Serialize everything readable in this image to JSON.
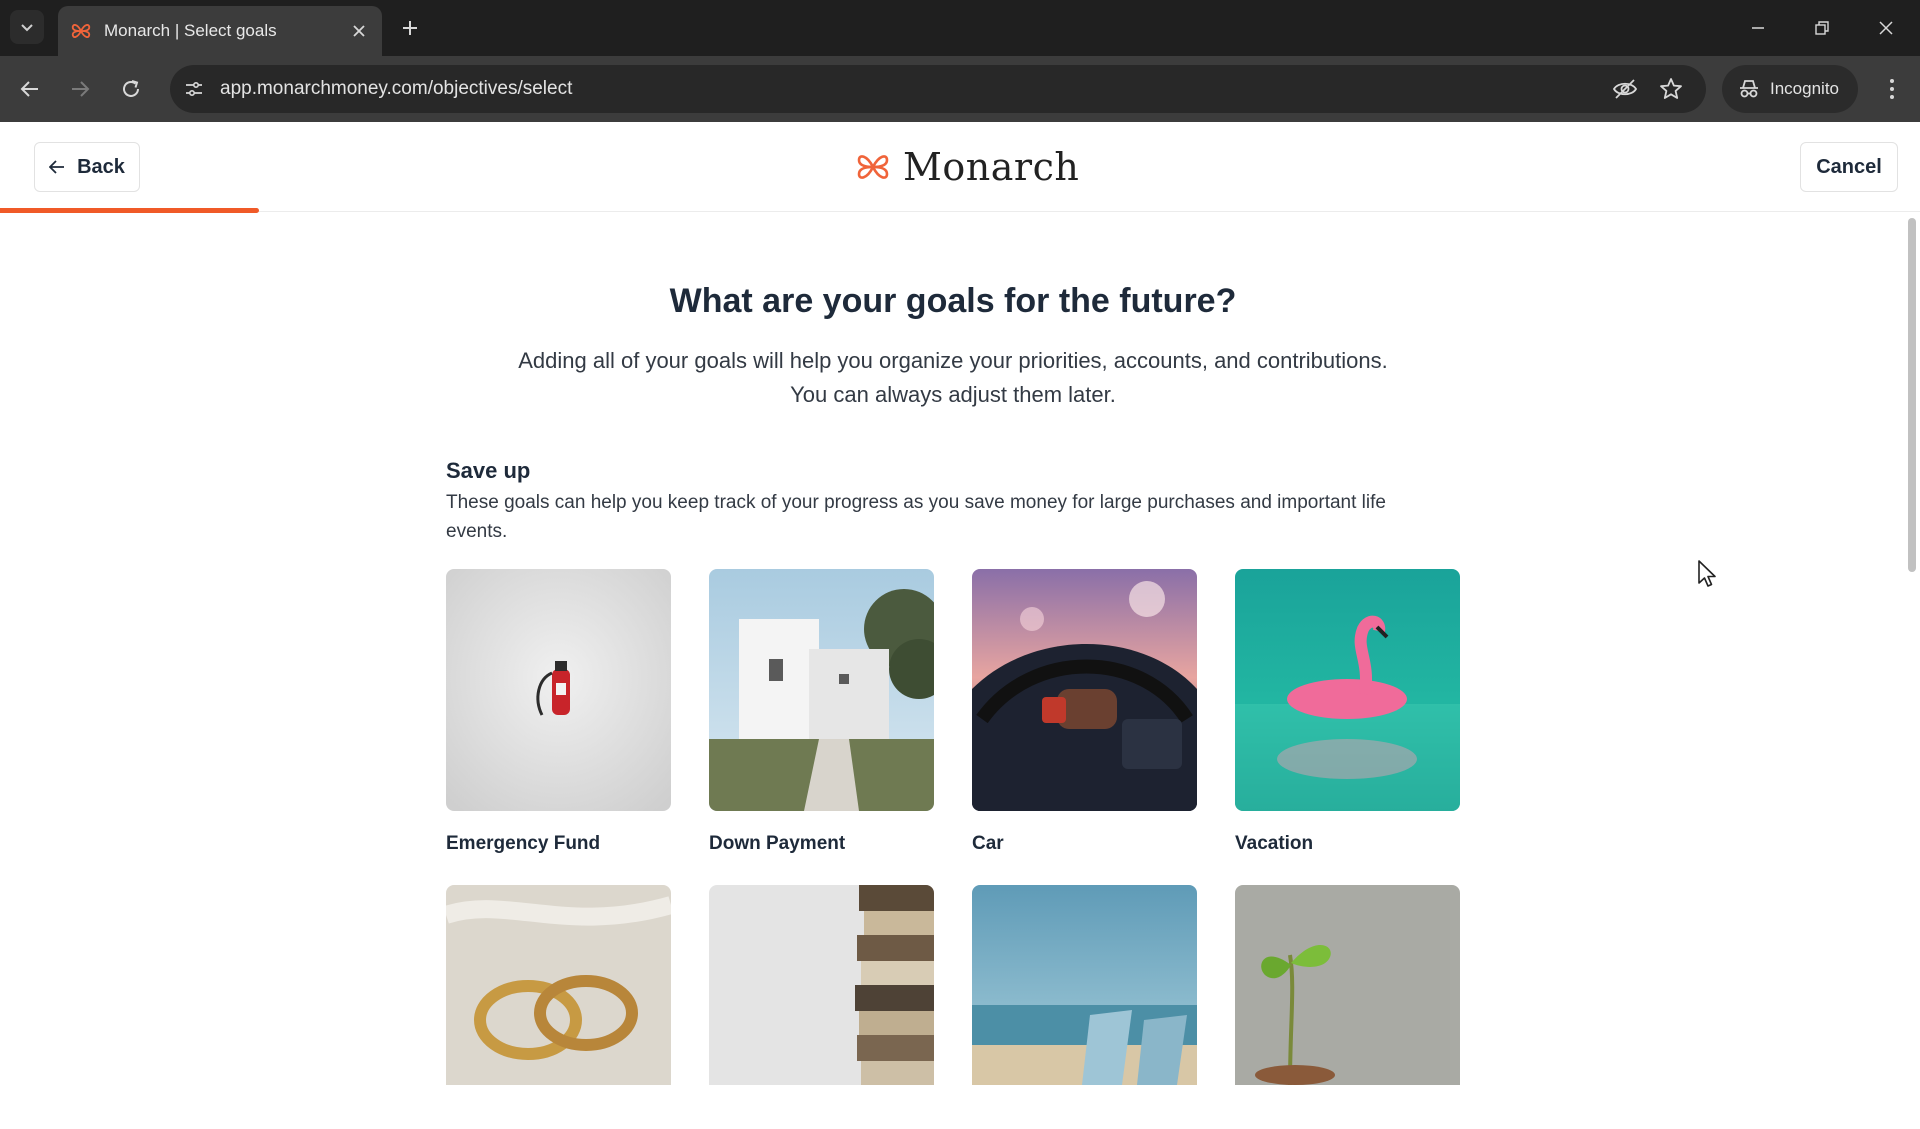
{
  "browser": {
    "tab_title": "Monarch | Select goals",
    "url": "app.monarchmoney.com/objectives/select",
    "profile_label": "Incognito"
  },
  "header": {
    "back_label": "Back",
    "brand_name": "Monarch",
    "cancel_label": "Cancel",
    "progress_fraction": 0.135,
    "accent_color": "#f05a28"
  },
  "main": {
    "heading": "What are your goals for the future?",
    "subtitle_line1": "Adding all of your goals will help you organize your priorities, accounts, and contributions.",
    "subtitle_line2": "You can always adjust them later."
  },
  "section": {
    "title": "Save up",
    "description": "These goals can help you keep track of your progress as you save money for large purchases and important life events.",
    "goals": [
      {
        "label": "Emergency Fund",
        "image": "fire-extinguisher-image"
      },
      {
        "label": "Down Payment",
        "image": "white-house-image"
      },
      {
        "label": "Car",
        "image": "car-driving-image"
      },
      {
        "label": "Vacation",
        "image": "flamingo-float-image"
      },
      {
        "label": "",
        "image": "wedding-rings-image"
      },
      {
        "label": "",
        "image": "stacked-books-image"
      },
      {
        "label": "",
        "image": "beach-chairs-image"
      },
      {
        "label": "",
        "image": "sprout-coins-image"
      }
    ]
  }
}
